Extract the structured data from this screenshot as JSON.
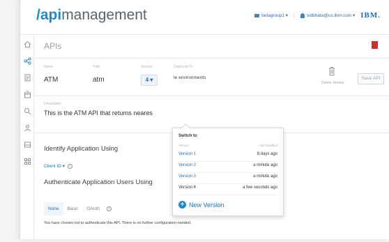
{
  "header": {
    "logo_prefix": "/api",
    "logo_suffix": "management",
    "org": "betagroup1",
    "org_caret": "▾",
    "user": "sidbhata@us.ibm.com",
    "user_caret": "▾",
    "brand": "IBM."
  },
  "page": {
    "title": "APIs"
  },
  "api": {
    "name_label": "Name",
    "name": "ATM",
    "path_label": "Path",
    "path": "atm",
    "version_label": "Version",
    "version_value": "4 ▾",
    "deployed_label": "Deployed To",
    "deployed_value": "te environments",
    "delete_label": "Delete Version",
    "save_label": "Save API",
    "description_label": "Description",
    "description": "This is the ATM API that returns neares"
  },
  "identify": {
    "title": "Identify Application Using",
    "client_id": "Client ID",
    "client_caret": "▾",
    "info": "i"
  },
  "authenticate": {
    "title": "Authenticate Application Users Using",
    "tabs": [
      "None",
      "Basic",
      "OAuth"
    ],
    "info": "i",
    "note": "You have chosen not to authenticate this API. There is no further configuration needed."
  },
  "version_menu": {
    "title": "Switch to",
    "col_version": "Version",
    "col_modified": "Last Modified",
    "rows": [
      {
        "version": "Version 1",
        "modified": "8 days ago"
      },
      {
        "version": "Version 2",
        "modified": "a minute ago"
      },
      {
        "version": "Version 3",
        "modified": "a minute ago"
      },
      {
        "version": "Version 4",
        "modified": "a few seconds ago"
      }
    ],
    "new_version": "New Version",
    "plus": "+"
  },
  "colors": {
    "accent": "#1f8ac9",
    "link": "#1f6fb5",
    "alert": "#d12d2d"
  },
  "sidebar_icons": [
    "home-icon",
    "share-icon",
    "document-icon",
    "box-icon",
    "search-icon",
    "user-icon",
    "stack-icon",
    "grid-icon"
  ]
}
